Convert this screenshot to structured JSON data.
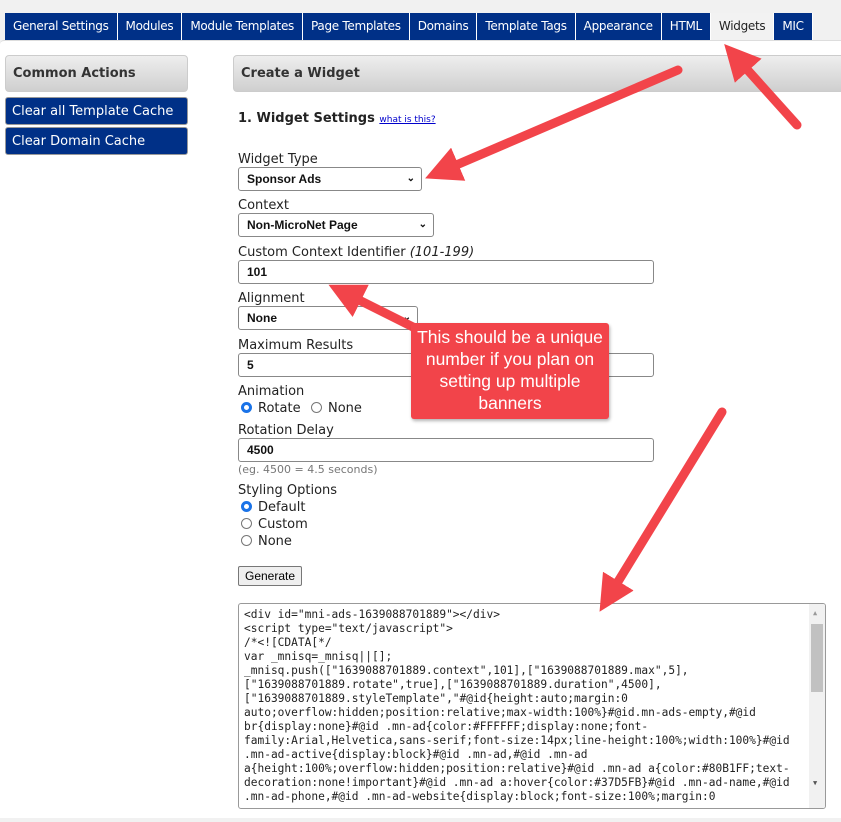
{
  "tabs": [
    {
      "label": "General Settings"
    },
    {
      "label": "Modules"
    },
    {
      "label": "Module Templates"
    },
    {
      "label": "Page Templates"
    },
    {
      "label": "Domains"
    },
    {
      "label": "Template Tags"
    },
    {
      "label": "Appearance"
    },
    {
      "label": "HTML"
    },
    {
      "label": "Widgets",
      "active": true
    },
    {
      "label": "MIC"
    }
  ],
  "sidebar": {
    "title": "Common Actions",
    "buttons": [
      "Clear all Template Cache",
      "Clear Domain Cache"
    ]
  },
  "main": {
    "title": "Create a Widget",
    "section": "1. Widget Settings",
    "help_link": "what is this?"
  },
  "form": {
    "widget_type": {
      "label": "Widget Type",
      "value": "Sponsor Ads"
    },
    "context": {
      "label": "Context",
      "value": "Non-MicroNet Page"
    },
    "custom_id": {
      "label": "Custom Context Identifier",
      "hint": "(101-199)",
      "value": "101"
    },
    "alignment": {
      "label": "Alignment",
      "value": "None"
    },
    "max_results": {
      "label": "Maximum Results",
      "value": "5"
    },
    "animation": {
      "label": "Animation",
      "options": [
        "Rotate",
        "None"
      ],
      "selected": "Rotate"
    },
    "rotation_delay": {
      "label": "Rotation Delay",
      "value": "4500",
      "hint": "(eg. 4500 = 4.5 seconds)"
    },
    "styling": {
      "label": "Styling Options",
      "options": [
        "Default",
        "Custom",
        "None"
      ],
      "selected": "Default"
    },
    "generate": "Generate"
  },
  "code": "<div id=\"mni-ads-1639088701889\"></div>\n<script type=\"text/javascript\">\n/*<![CDATA[*/\nvar _mnisq=_mnisq||[];\n_mnisq.push([\"1639088701889.context\",101],[\"1639088701889.max\",5],\n[\"1639088701889.rotate\",true],[\"1639088701889.duration\",4500],\n[\"1639088701889.styleTemplate\",\"#@id{height:auto;margin:0\nauto;overflow:hidden;position:relative;max-width:100%}#@id.mn-ads-empty,#@id\nbr{display:none}#@id .mn-ad{color:#FFFFFF;display:none;font-\nfamily:Arial,Helvetica,sans-serif;font-size:14px;line-height:100%;width:100%}#@id\n.mn-ad-active{display:block}#@id .mn-ad,#@id .mn-ad\na{height:100%;overflow:hidden;position:relative}#@id .mn-ad a{color:#80B1FF;text-\ndecoration:none!important}#@id .mn-ad a:hover{color:#37D5FB}#@id .mn-ad-name,#@id\n.mn-ad-phone,#@id .mn-ad-website{display:block;font-size:100%;margin:0",
  "callout": "This should be a unique number if you plan on setting up multiple banners",
  "colors": {
    "tab_bg": "#003087",
    "annotation": "#f2444a",
    "radio": "#1a73e8"
  }
}
